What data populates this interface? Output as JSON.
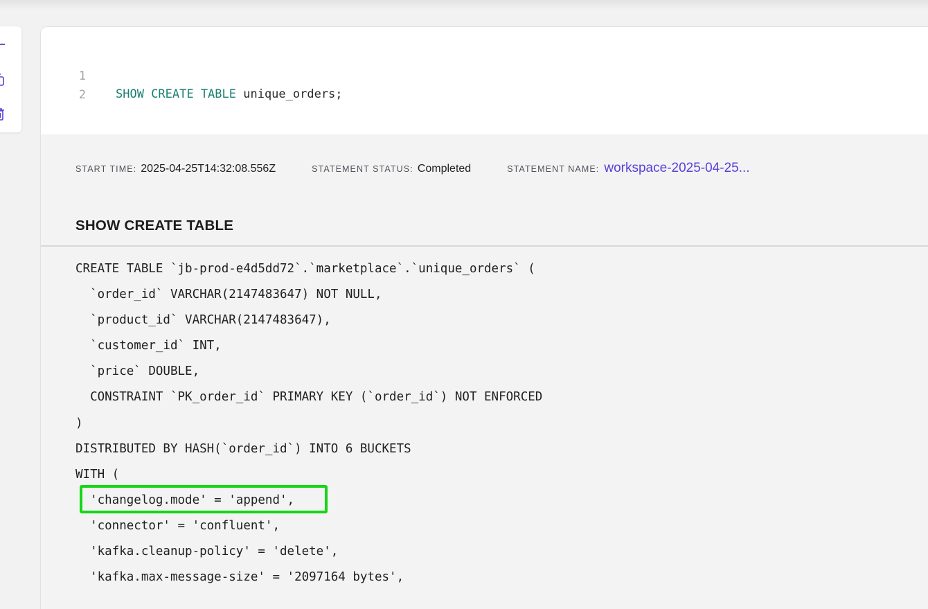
{
  "toolbar": {
    "icons": [
      "plus-icon",
      "copy-icon",
      "trash-icon"
    ]
  },
  "editor": {
    "line_numbers": [
      "1",
      "2"
    ],
    "code": {
      "keyword": "SHOW CREATE TABLE",
      "rest": " unique_orders;"
    }
  },
  "results": {
    "start_time_label": "START TIME:",
    "start_time_value": "2025-04-25T14:32:08.556Z",
    "status_label": "STATEMENT STATUS:",
    "status_value": "Completed",
    "name_label": "STATEMENT NAME:",
    "name_value": "workspace-2025-04-25...",
    "title": "SHOW CREATE TABLE",
    "ddl_lines": [
      "CREATE TABLE `jb-prod-e4d5dd72`.`marketplace`.`unique_orders` (",
      "  `order_id` VARCHAR(2147483647) NOT NULL,",
      "  `product_id` VARCHAR(2147483647),",
      "  `customer_id` INT,",
      "  `price` DOUBLE,",
      "  CONSTRAINT `PK_order_id` PRIMARY KEY (`order_id`) NOT ENFORCED",
      ")",
      "DISTRIBUTED BY HASH(`order_id`) INTO 6 BUCKETS",
      "WITH (",
      "  'changelog.mode' = 'append',",
      "  'connector' = 'confluent',",
      "  'kafka.cleanup-policy' = 'delete',",
      "  'kafka.max-message-size' = '2097164 bytes',"
    ]
  },
  "colors": {
    "keyword": "#1b7f72",
    "link": "#5b3fd6",
    "highlight": "#16d616"
  }
}
